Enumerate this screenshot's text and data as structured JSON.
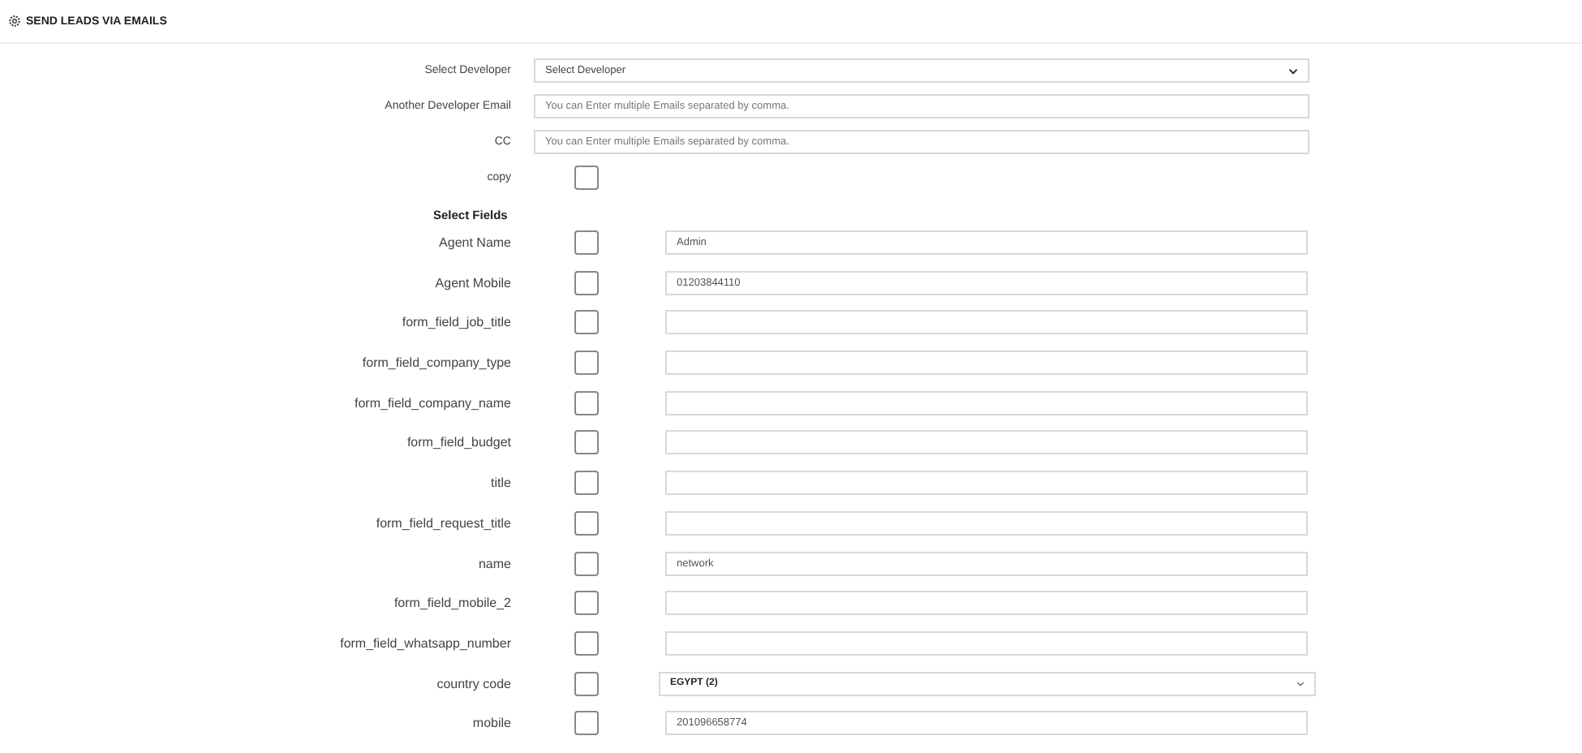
{
  "header": {
    "title": "SEND LEADS VIA EMAILS"
  },
  "settings": [
    {
      "kind": "select",
      "label": "Select Developer",
      "value": "Select Developer"
    },
    {
      "kind": "text",
      "label": "Another Developer Email",
      "placeholder": "You can Enter multiple Emails separated by comma."
    },
    {
      "kind": "text",
      "label": "CC",
      "placeholder": "You can Enter multiple Emails separated by comma."
    },
    {
      "kind": "checkbox",
      "label": "copy",
      "checked": false
    }
  ],
  "fields_heading": "Select Fields",
  "fields": [
    {
      "kind": "text",
      "label": "Agent Name",
      "checked": false,
      "value": "Admin"
    },
    {
      "kind": "text",
      "label": "Agent Mobile",
      "checked": false,
      "value": "01203844110"
    },
    {
      "kind": "text",
      "label": "form_field_job_title",
      "checked": false
    },
    {
      "kind": "text",
      "label": "form_field_company_type",
      "checked": false
    },
    {
      "kind": "text",
      "label": "form_field_company_name",
      "checked": false
    },
    {
      "kind": "text",
      "label": "form_field_budget",
      "checked": false
    },
    {
      "kind": "text",
      "label": "title",
      "checked": false
    },
    {
      "kind": "text",
      "label": "form_field_request_title",
      "checked": false
    },
    {
      "kind": "text",
      "label": "name",
      "checked": false,
      "value": "network"
    },
    {
      "kind": "text",
      "label": "form_field_mobile_2",
      "checked": false
    },
    {
      "kind": "text",
      "label": "form_field_whatsapp_number",
      "checked": false
    },
    {
      "kind": "select",
      "label": "country code",
      "checked": false,
      "value": "EGYPT (2)"
    },
    {
      "kind": "text",
      "label": "mobile",
      "checked": false,
      "value": "201096658774"
    }
  ]
}
